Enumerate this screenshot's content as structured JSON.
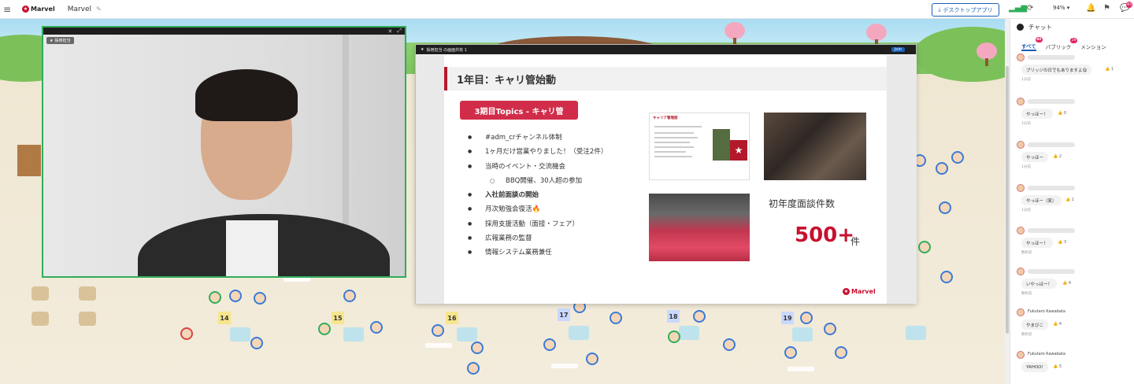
{
  "topbar": {
    "logo_text": "Marvel",
    "space_name": "Marvel",
    "desktop_app_label": "デスクトップアプリ",
    "zoom": "94%",
    "notif_count": "43"
  },
  "video": {
    "label": "採用担当"
  },
  "slide_window": {
    "presenter_label": "採用担当 の画面共有 1",
    "join_label": "Join"
  },
  "slide": {
    "title": "1年目：キャリ管始動",
    "topics_pill": "3期目Topics - キャリ管",
    "bullets": [
      "#adm_crチャンネル体制",
      "1ヶ月だけ営業やりました！（受注2件）",
      "当時のイベント・交流機会",
      "BBQ開催、30人超の参加",
      "入社前面談の開始",
      "月次勉強会復活🔥",
      "採用支援活動（面接・フェア）",
      "広報業務の監督",
      "情報システム業務兼任"
    ],
    "thumb_title": "キャリア管理部",
    "count_label": "初年度面談件数",
    "count_value": "500+",
    "count_unit": "件",
    "logo_text": "Marvel"
  },
  "world": {
    "tables": [
      "14",
      "15",
      "16",
      "17",
      "18",
      "19"
    ]
  },
  "chat": {
    "title": "チャット",
    "tabs": [
      {
        "label": "すべて",
        "badge": "40"
      },
      {
        "label": "パブリック",
        "badge": "29"
      },
      {
        "label": "メンション",
        "badge": ""
      }
    ],
    "messages": [
      {
        "user": "",
        "text": "ブリッジの日でもありますよ😋",
        "reactions": "👍 1",
        "time": "1分前"
      },
      {
        "user": "",
        "text": "やっほー！",
        "reactions": "👍 0",
        "time": "1分前"
      },
      {
        "user": "",
        "text": "やっほー",
        "reactions": "👍 2",
        "time": "1分前"
      },
      {
        "user": "",
        "text": "やっほー（笑）",
        "reactions": "👍 1",
        "time": "1分前"
      },
      {
        "user": "",
        "text": "やっほー！",
        "reactions": "👍 3",
        "time": "数秒前"
      },
      {
        "user": "",
        "text": "いやっほー！",
        "reactions": "👍 4",
        "time": "数秒前"
      },
      {
        "user": "Fukutaro Kawabata",
        "text": "やまびこ",
        "reactions": "👍 4",
        "time": "数秒前"
      },
      {
        "user": "Fukutaro Kawabata",
        "text": "YAHOO!",
        "reactions": "👍 5",
        "time": ""
      }
    ]
  },
  "colors": {
    "accent_blue": "#1a5fb4",
    "brand_red": "#c8102e",
    "topics_pink": "#d12d4a",
    "video_border": "#2fae5a"
  }
}
